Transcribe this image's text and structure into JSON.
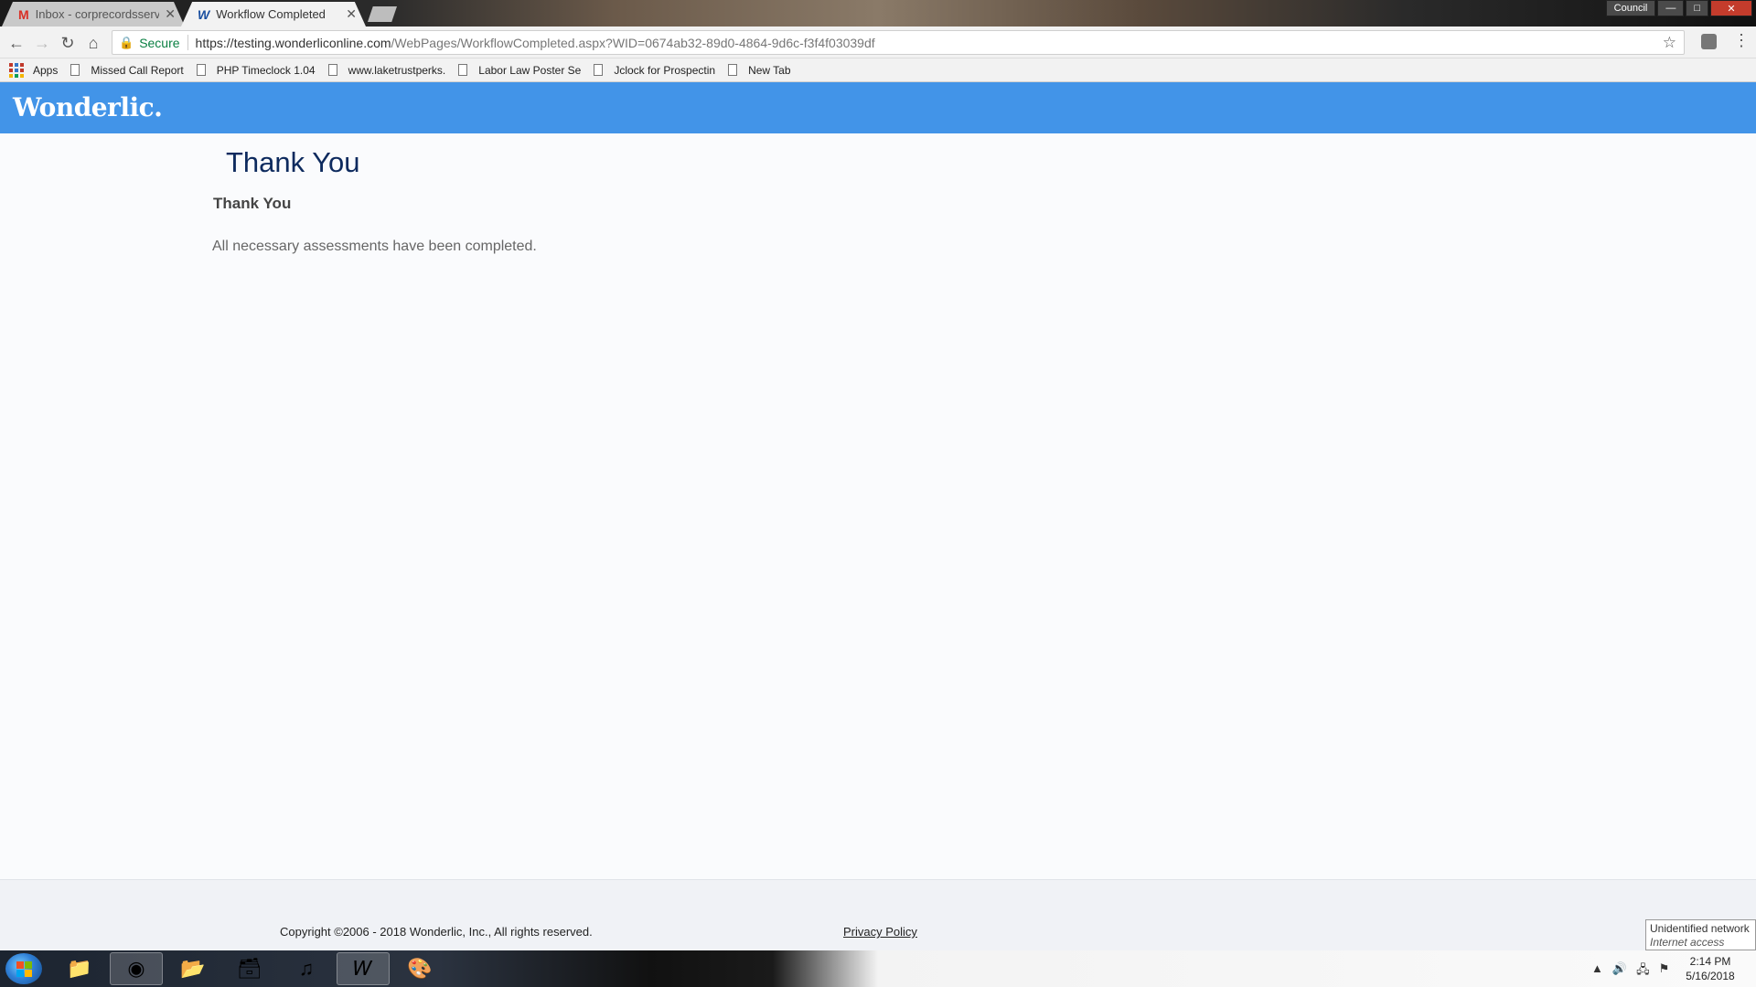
{
  "browser": {
    "tabs": [
      {
        "title": "Inbox - corprecordsservic",
        "favicon": "gmail-icon",
        "active": false
      },
      {
        "title": "Workflow Completed",
        "favicon": "wonderlic-w-icon",
        "active": true
      }
    ],
    "window_controls": {
      "profile": "Council"
    },
    "security_label": "Secure",
    "url_host": "https://testing.wonderliconline.com",
    "url_path": "/WebPages/WorkflowCompleted.aspx?WID=0674ab32-89d0-4864-9d6c-f3f4f03039df",
    "bookmarks": {
      "apps": "Apps",
      "items": [
        "Missed Call Report",
        "PHP Timeclock 1.04",
        "www.laketrustperks.",
        "Labor Law Poster Se",
        "Jclock for Prospectin",
        "New Tab"
      ]
    }
  },
  "page": {
    "logo": "Wonderlic.",
    "heading": "Thank You",
    "subheading": "Thank You",
    "message": "All necessary assessments have been completed.",
    "footer": {
      "copyright": "Copyright ©2006 - 2018 Wonderlic, Inc., All rights reserved.",
      "privacy": "Privacy Policy"
    }
  },
  "system": {
    "network_tooltip": {
      "title": "Unidentified network",
      "subtitle": "Internet access"
    },
    "clock": {
      "time": "2:14 PM",
      "date": "5/16/2018"
    }
  },
  "colors": {
    "brand_blue": "#4294e8",
    "heading_navy": "#0d2a5e",
    "secure_green": "#0b8043"
  }
}
